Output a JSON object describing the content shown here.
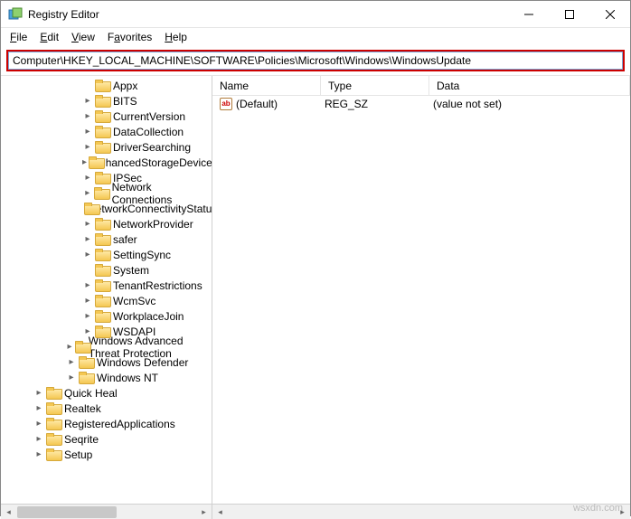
{
  "window": {
    "title": "Registry Editor",
    "icon": "regedit-icon"
  },
  "menu": {
    "file": "File",
    "edit": "Edit",
    "view": "View",
    "favorites": "Favorites",
    "help": "Help"
  },
  "address": {
    "value": "Computer\\HKEY_LOCAL_MACHINE\\SOFTWARE\\Policies\\Microsoft\\Windows\\WindowsUpdate"
  },
  "columns": {
    "name": "Name",
    "type": "Type",
    "data": "Data"
  },
  "values": [
    {
      "icon": "ab",
      "name": "(Default)",
      "type": "REG_SZ",
      "data": "(value not set)"
    }
  ],
  "tree": {
    "nodes": [
      {
        "depth": 5,
        "tw": "none",
        "label": "Appx"
      },
      {
        "depth": 5,
        "tw": "closed",
        "label": "BITS"
      },
      {
        "depth": 5,
        "tw": "closed",
        "label": "CurrentVersion"
      },
      {
        "depth": 5,
        "tw": "closed",
        "label": "DataCollection"
      },
      {
        "depth": 5,
        "tw": "closed",
        "label": "DriverSearching"
      },
      {
        "depth": 5,
        "tw": "closed",
        "label": "EnhancedStorageDevices"
      },
      {
        "depth": 5,
        "tw": "closed",
        "label": "IPSec"
      },
      {
        "depth": 5,
        "tw": "closed",
        "label": "Network Connections"
      },
      {
        "depth": 5,
        "tw": "none",
        "label": "NetworkConnectivityStatusIndicator"
      },
      {
        "depth": 5,
        "tw": "closed",
        "label": "NetworkProvider"
      },
      {
        "depth": 5,
        "tw": "closed",
        "label": "safer"
      },
      {
        "depth": 5,
        "tw": "closed",
        "label": "SettingSync"
      },
      {
        "depth": 5,
        "tw": "none",
        "label": "System"
      },
      {
        "depth": 5,
        "tw": "closed",
        "label": "TenantRestrictions"
      },
      {
        "depth": 5,
        "tw": "closed",
        "label": "WcmSvc"
      },
      {
        "depth": 5,
        "tw": "closed",
        "label": "WorkplaceJoin"
      },
      {
        "depth": 5,
        "tw": "closed",
        "label": "WSDAPI"
      },
      {
        "depth": 4,
        "tw": "closed",
        "label": "Windows Advanced Threat Protection"
      },
      {
        "depth": 4,
        "tw": "closed",
        "label": "Windows Defender"
      },
      {
        "depth": 4,
        "tw": "closed",
        "label": "Windows NT"
      },
      {
        "depth": 2,
        "tw": "closed",
        "label": "Quick Heal"
      },
      {
        "depth": 2,
        "tw": "closed",
        "label": "Realtek"
      },
      {
        "depth": 2,
        "tw": "closed",
        "label": "RegisteredApplications"
      },
      {
        "depth": 2,
        "tw": "closed",
        "label": "Seqrite"
      },
      {
        "depth": 2,
        "tw": "closed",
        "label": "Setup"
      }
    ]
  },
  "watermark": "wsxdn.com"
}
